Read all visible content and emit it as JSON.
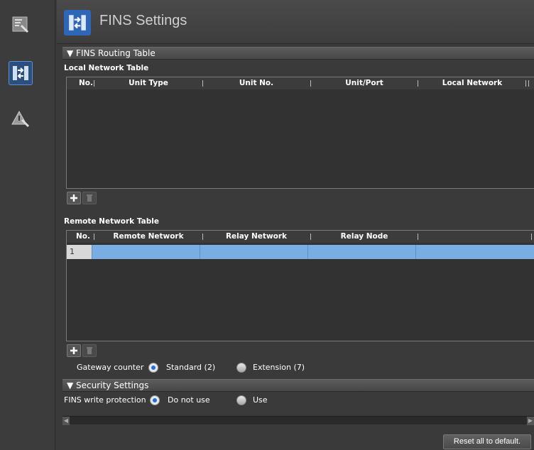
{
  "header": {
    "title": "FINS Settings"
  },
  "routing": {
    "section_title": "▼ FINS Routing Table",
    "local": {
      "label": "Local Network Table",
      "columns": [
        "No.",
        "Unit Type",
        "Unit No.",
        "Unit/Port",
        "Local Network"
      ]
    },
    "remote": {
      "label": "Remote Network Table",
      "columns": [
        "No.",
        "Remote Network",
        "Relay Network",
        "Relay Node"
      ],
      "rows": [
        {
          "no": "1"
        }
      ]
    },
    "gateway": {
      "label": "Gateway counter",
      "options": [
        "Standard (2)",
        "Extension (7)"
      ],
      "selected": "Standard (2)"
    }
  },
  "security": {
    "section_title": "▼ Security Settings",
    "label": "FINS write protection",
    "options": [
      "Do not use",
      "Use"
    ],
    "selected": "Do not use"
  },
  "footer": {
    "reset_label": "Reset all to default."
  },
  "icons": {
    "sidebar": [
      "settings-tool-icon",
      "fins-transfer-icon",
      "warning-wrench-icon"
    ],
    "header": "fins-transfer-icon",
    "add": "plus-icon",
    "delete": "trash-icon"
  },
  "colors": {
    "accent": "#2f67b8",
    "selected_row": "#7aaee2",
    "radio_selected": "#1e6fd8"
  }
}
